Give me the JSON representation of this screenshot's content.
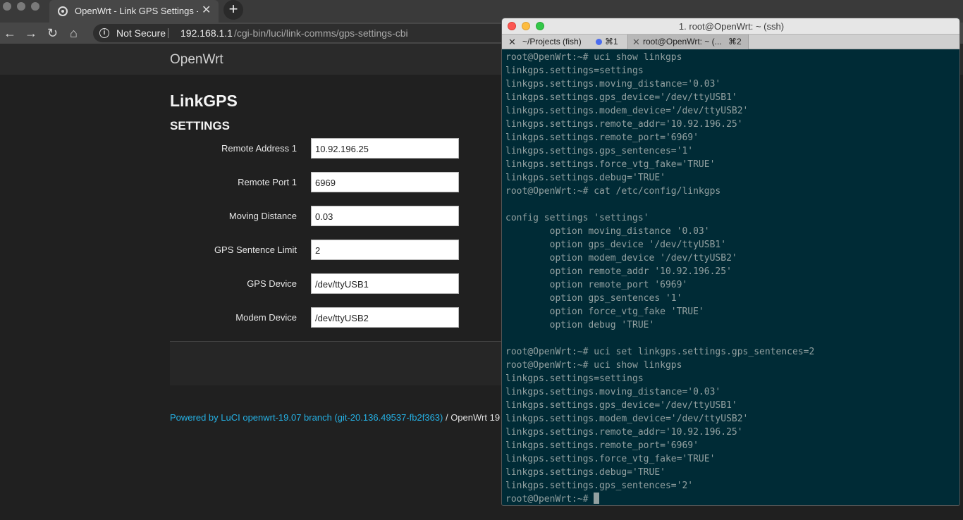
{
  "browser": {
    "tab_title": "OpenWrt - Link GPS Settings - LuCI",
    "tab_close": "✕",
    "new_tab": "+",
    "security_label": "Not Secure",
    "url_host": "192.168.1.1",
    "url_path": "/cgi-bin/luci/link-comms/gps-settings-cbi"
  },
  "luci": {
    "brand": "OpenWrt",
    "page_title": "LinkGPS",
    "section_title": "SETTINGS",
    "fields": [
      {
        "label": "Remote Address 1",
        "value": "10.92.196.25"
      },
      {
        "label": "Remote Port 1",
        "value": "6969"
      },
      {
        "label": "Moving Distance",
        "value": "0.03"
      },
      {
        "label": "GPS Sentence Limit",
        "value": "2"
      },
      {
        "label": "GPS Device",
        "value": "/dev/ttyUSB1"
      },
      {
        "label": "Modem Device",
        "value": "/dev/ttyUSB2"
      }
    ],
    "footer_link": "Powered by LuCI openwrt-19.07 branch (git-20.136.49537-fb2f363)",
    "footer_text": " / OpenWrt 19"
  },
  "terminal": {
    "title": "1. root@OpenWrt: ~ (ssh)",
    "tabs": [
      {
        "close": "✕",
        "label": "~/Projects (fish)",
        "shortcut": "⌘1"
      },
      {
        "close": "✕",
        "label": "root@OpenWrt: ~ (...",
        "shortcut": "⌘2"
      }
    ],
    "lines": [
      "root@OpenWrt:~# uci show linkgps",
      "linkgps.settings=settings",
      "linkgps.settings.moving_distance='0.03'",
      "linkgps.settings.gps_device='/dev/ttyUSB1'",
      "linkgps.settings.modem_device='/dev/ttyUSB2'",
      "linkgps.settings.remote_addr='10.92.196.25'",
      "linkgps.settings.remote_port='6969'",
      "linkgps.settings.gps_sentences='1'",
      "linkgps.settings.force_vtg_fake='TRUE'",
      "linkgps.settings.debug='TRUE'",
      "root@OpenWrt:~# cat /etc/config/linkgps",
      "",
      "config settings 'settings'",
      "        option moving_distance '0.03'",
      "        option gps_device '/dev/ttyUSB1'",
      "        option modem_device '/dev/ttyUSB2'",
      "        option remote_addr '10.92.196.25'",
      "        option remote_port '6969'",
      "        option gps_sentences '1'",
      "        option force_vtg_fake 'TRUE'",
      "        option debug 'TRUE'",
      "",
      "root@OpenWrt:~# uci set linkgps.settings.gps_sentences=2",
      "root@OpenWrt:~# uci show linkgps",
      "linkgps.settings=settings",
      "linkgps.settings.moving_distance='0.03'",
      "linkgps.settings.gps_device='/dev/ttyUSB1'",
      "linkgps.settings.modem_device='/dev/ttyUSB2'",
      "linkgps.settings.remote_addr='10.92.196.25'",
      "linkgps.settings.remote_port='6969'",
      "linkgps.settings.force_vtg_fake='TRUE'",
      "linkgps.settings.debug='TRUE'",
      "linkgps.settings.gps_sentences='2'"
    ],
    "prompt": "root@OpenWrt:~# "
  }
}
